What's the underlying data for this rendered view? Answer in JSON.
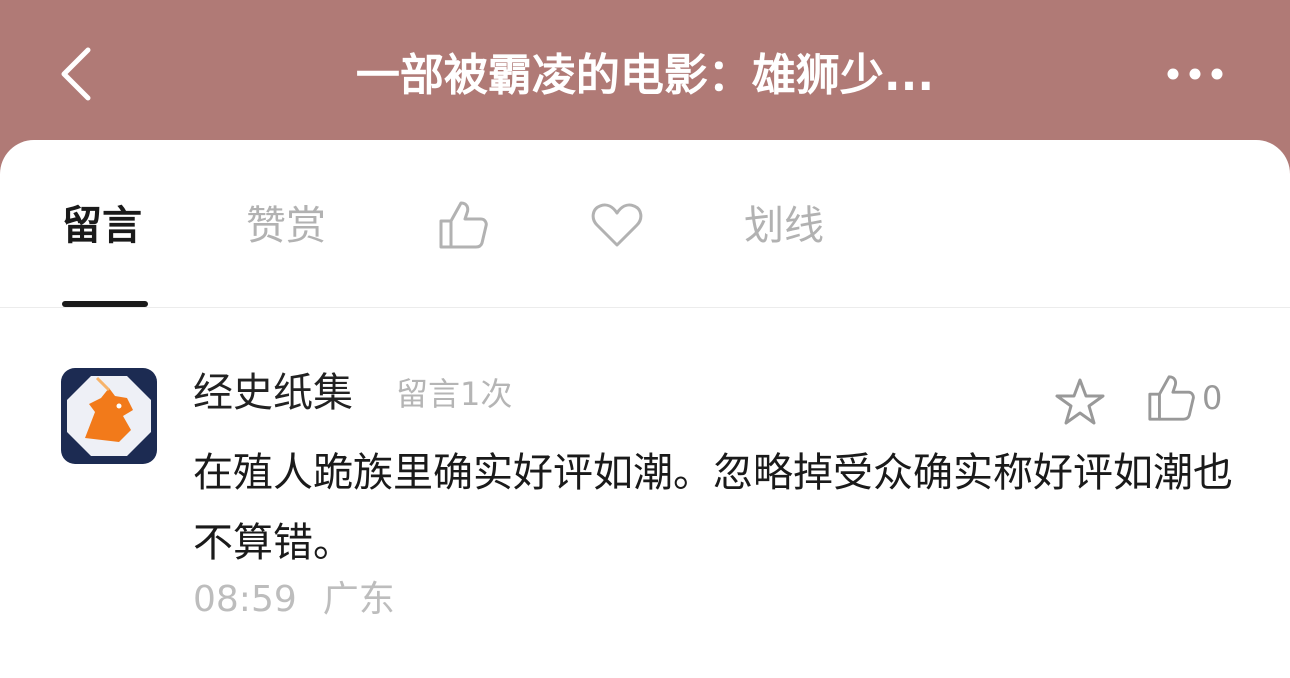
{
  "header": {
    "title": "一部被霸凌的电影：雄狮少...",
    "back_icon": "chevron-left-icon",
    "more_icon": "more-dots-icon"
  },
  "tabs": [
    {
      "label": "留言",
      "active": true
    },
    {
      "label": "赞赏",
      "active": false
    },
    {
      "icon": "thumbs-up-icon"
    },
    {
      "icon": "heart-icon"
    },
    {
      "label": "划线",
      "active": false
    }
  ],
  "comment": {
    "username": "经史纸集",
    "comment_count": "留言1次",
    "text": "在殖人跪族里确实好评如潮。忽略掉受众确实称好评如潮也不算错。",
    "time": "08:59",
    "location": "广东",
    "like_count": "0",
    "avatar_icon": "unicorn-icon"
  },
  "colors": {
    "header_bg": "#b07a76",
    "active_text": "#1a1a1a",
    "inactive_text": "#b2b2b2"
  }
}
